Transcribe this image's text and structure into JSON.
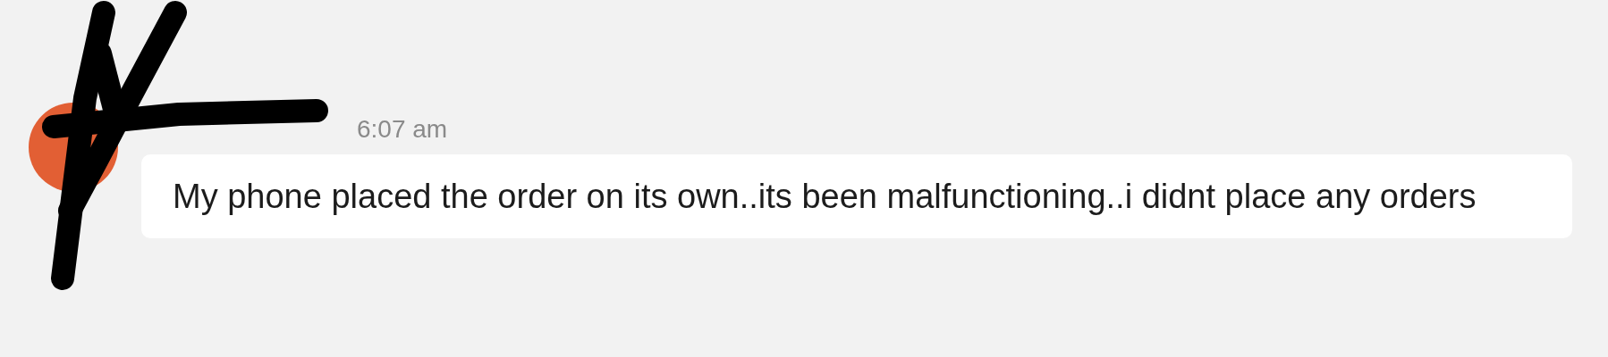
{
  "message": {
    "timestamp": "6:07 am",
    "text": "My phone placed the order on its own..its been malfunctioning..i didnt place any orders"
  }
}
